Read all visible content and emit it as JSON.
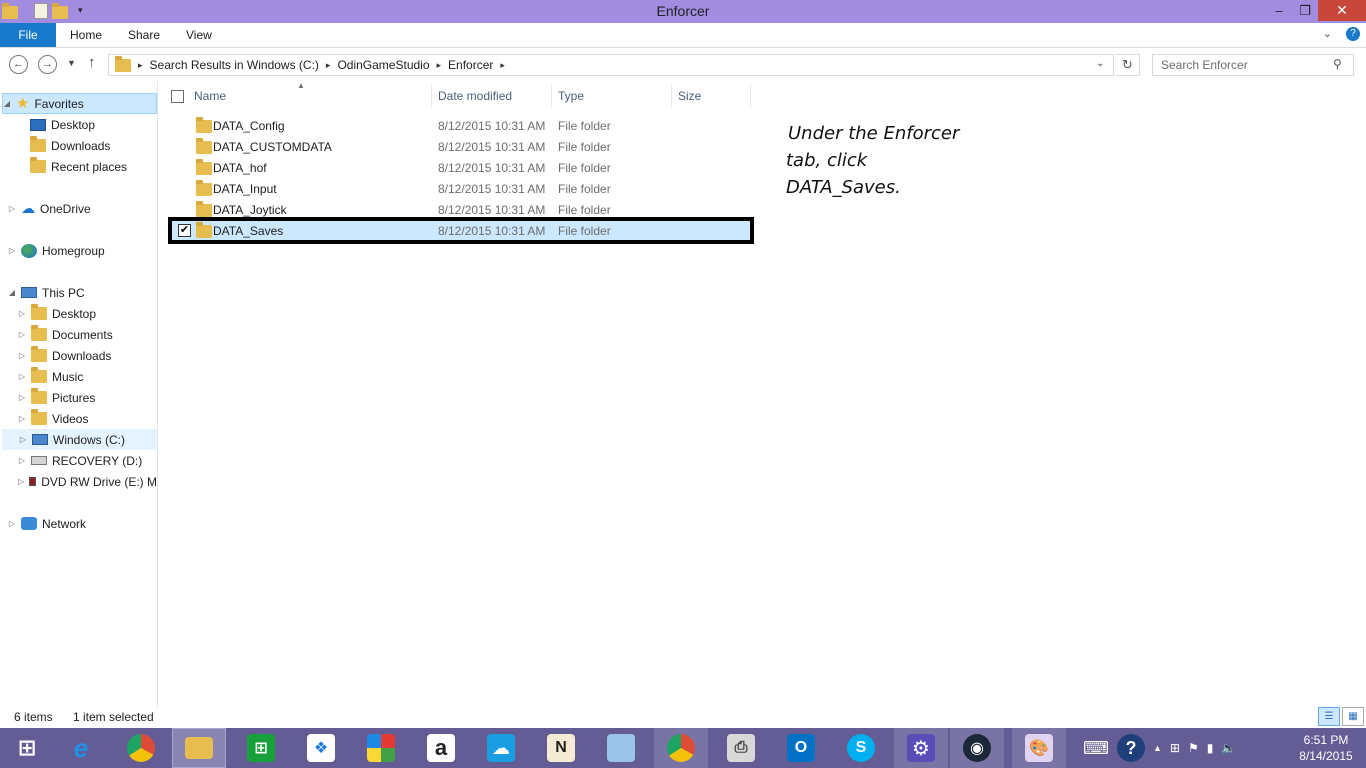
{
  "window": {
    "title": "Enforcer",
    "controls": {
      "minimize": "‒",
      "maximize": "❐",
      "close": "✕"
    }
  },
  "ribbon": {
    "tabs": [
      "File",
      "Home",
      "Share",
      "View"
    ],
    "help": "?"
  },
  "address": {
    "crumbs": [
      "Search Results in Windows (C:)",
      "OdinGameStudio",
      "Enforcer"
    ],
    "search_placeholder": "Search Enforcer"
  },
  "sidebar": {
    "favorites": {
      "label": "Favorites",
      "items": [
        "Desktop",
        "Downloads",
        "Recent places"
      ]
    },
    "onedrive": "OneDrive",
    "homegroup": "Homegroup",
    "thispc": {
      "label": "This PC",
      "items": [
        "Desktop",
        "Documents",
        "Downloads",
        "Music",
        "Pictures",
        "Videos",
        "Windows (C:)",
        "RECOVERY (D:)",
        "DVD RW Drive (E:) M"
      ]
    },
    "network": "Network"
  },
  "columns": {
    "name": "Name",
    "date": "Date modified",
    "type": "Type",
    "size": "Size"
  },
  "files": [
    {
      "name": "DATA_Config",
      "date": "8/12/2015 10:31 AM",
      "type": "File folder"
    },
    {
      "name": "DATA_CUSTOMDATA",
      "date": "8/12/2015 10:31 AM",
      "type": "File folder"
    },
    {
      "name": "DATA_hof",
      "date": "8/12/2015 10:31 AM",
      "type": "File folder"
    },
    {
      "name": "DATA_Input",
      "date": "8/12/2015 10:31 AM",
      "type": "File folder"
    },
    {
      "name": "DATA_Joytick",
      "date": "8/12/2015 10:31 AM",
      "type": "File folder"
    },
    {
      "name": "DATA_Saves",
      "date": "8/12/2015 10:31 AM",
      "type": "File folder",
      "selected": true
    }
  ],
  "annotation": {
    "line1": "Under the Enforcer",
    "line2": "tab, click",
    "line3": "DATA_Saves."
  },
  "status": {
    "count": "6 items",
    "selection": "1 item selected"
  },
  "clock": {
    "time": "6:51 PM",
    "date": "8/14/2015"
  },
  "taskbar": {
    "apps": [
      "start",
      "internet-explorer",
      "chrome",
      "file-explorer",
      "store",
      "dropbox",
      "game-app",
      "amazon",
      "onedrive",
      "notepad",
      "notes",
      "chrome",
      "fax",
      "outlook",
      "skype",
      "settings",
      "steam",
      "paint"
    ],
    "colors": {
      "bar": "#645c94",
      "ie": "#1e90e8",
      "chrome": "#dd4b39",
      "store": "#18a03a",
      "dropbox": "#1e78e0",
      "amazon": "#222222",
      "outlook": "#0072c6",
      "skype": "#00aff0",
      "settings": "#5a4db8",
      "steam": "#1b2838"
    }
  }
}
